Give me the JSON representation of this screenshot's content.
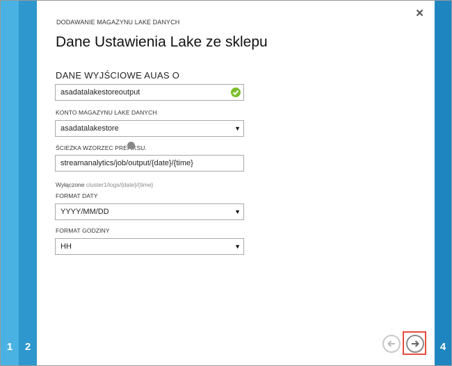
{
  "wizard": {
    "steps": [
      "1",
      "2",
      "4"
    ],
    "breadcrumb": "DODAWANIE MAGAZYNU LAKE DANYCH",
    "title": "Dane Ustawienia Lake ze sklepu",
    "close_icon": "×"
  },
  "form": {
    "section_label": "DANE WYJŚCIOWE AUAS O",
    "output_alias": {
      "value": "asadatalakestoreoutput",
      "status": "valid"
    },
    "account": {
      "label": "KONTO MAGAZYNU LAKE DANYCH",
      "value": "asadatalakestore"
    },
    "path_prefix": {
      "label": "ŚCIEŻKA WZORZEC PREFIKSU.",
      "value": "streamanalytics/job/output/{date}/{time}"
    },
    "hint": {
      "prefix": "Wyłączone",
      "example": "cluster1/logs/{date}/{time}"
    },
    "date_format": {
      "label": "FORMAT DATY",
      "value": "YYYY/MM/DD"
    },
    "time_format": {
      "label": "FORMAT GODZINY",
      "value": "HH"
    }
  },
  "colors": {
    "accent": "#2e97cd",
    "success": "#7cbf2e",
    "highlight": "#e84a3a"
  },
  "icons": {
    "dropdown": "chevron-down-icon",
    "prev": "arrow-left-icon",
    "next": "arrow-right-icon",
    "valid": "check-circle-icon"
  }
}
